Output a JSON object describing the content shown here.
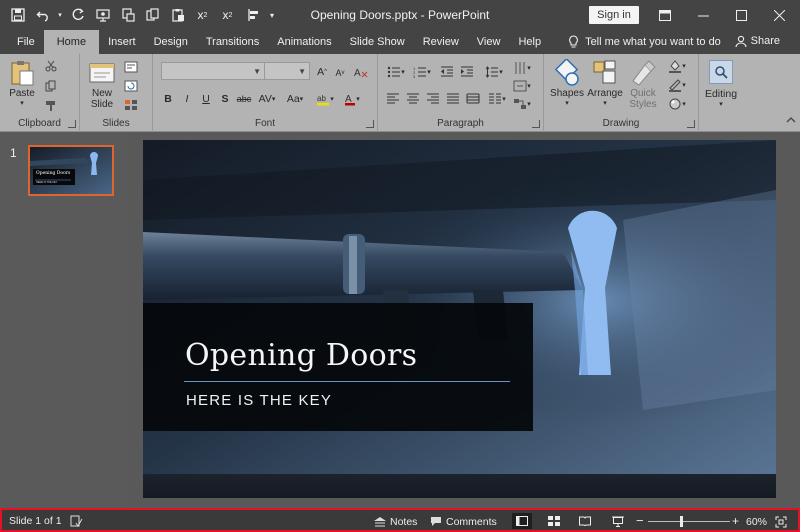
{
  "window": {
    "title": "Opening Doors.pptx - PowerPoint",
    "sign_in": "Sign in"
  },
  "tabs": [
    "File",
    "Home",
    "Insert",
    "Design",
    "Transitions",
    "Animations",
    "Slide Show",
    "Review",
    "View",
    "Help"
  ],
  "active_tab": "Home",
  "tell_me": "Tell me what you want to do",
  "share": "Share",
  "ribbon": {
    "clipboard": {
      "label": "Clipboard",
      "paste": "Paste"
    },
    "slides": {
      "label": "Slides",
      "new_slide_line1": "New",
      "new_slide_line2": "Slide"
    },
    "font": {
      "label": "Font",
      "bold": "B",
      "italic": "I",
      "underline": "U",
      "strike": "S",
      "shadow": "abc",
      "spacing": "AV",
      "case": "Aa",
      "grow": "A",
      "shrink": "A",
      "color": "A"
    },
    "paragraph": {
      "label": "Paragraph"
    },
    "drawing": {
      "label": "Drawing",
      "shapes": "Shapes",
      "arrange": "Arrange",
      "quick_styles_line1": "Quick",
      "quick_styles_line2": "Styles"
    },
    "editing": {
      "label": "Editing"
    }
  },
  "thumbnails": [
    {
      "number": "1",
      "title": "Opening Doors",
      "subtitle": "HERE IS THE KEY"
    }
  ],
  "slide": {
    "title": "Opening Doors",
    "subtitle": "HERE IS THE KEY"
  },
  "status": {
    "slide_indicator": "Slide 1 of 1",
    "notes": "Notes",
    "comments": "Comments",
    "zoom": "60%",
    "zoom_fraction": 0.4
  },
  "colors": {
    "accent": "#e0642c",
    "status_highlight": "#e81123",
    "title_rule": "#6a96c4"
  }
}
